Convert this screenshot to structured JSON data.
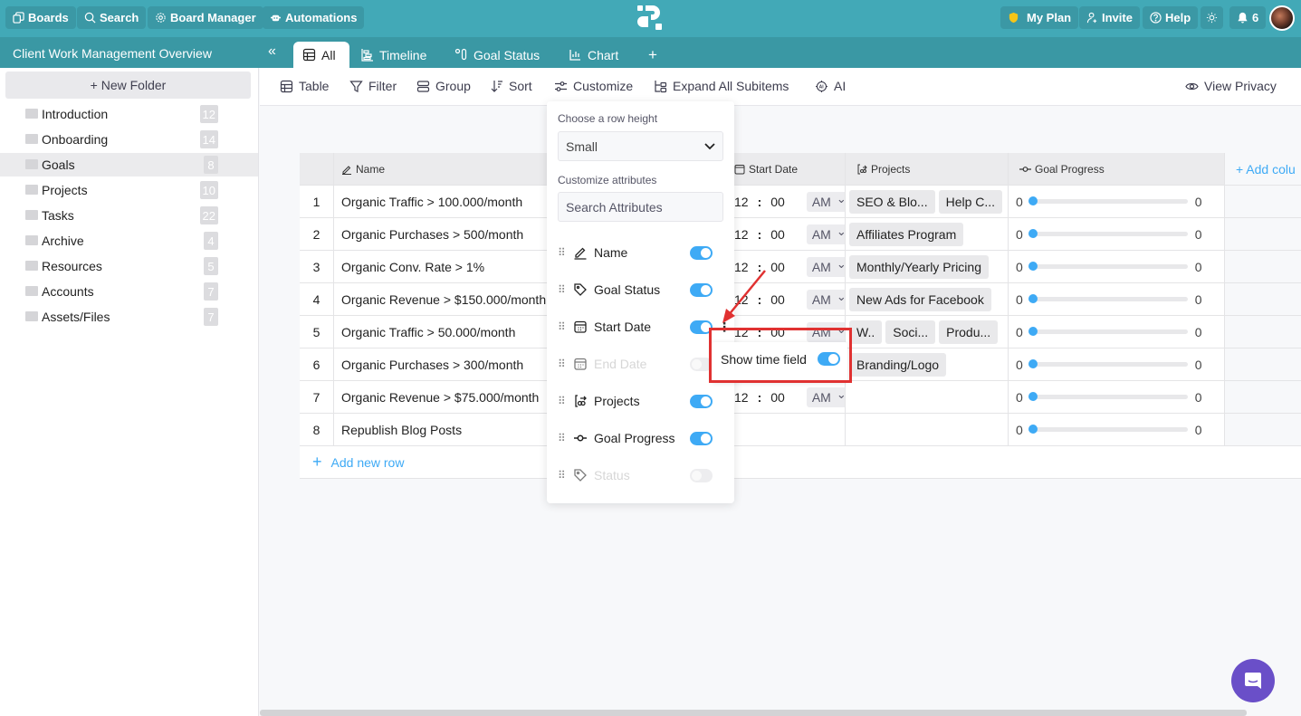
{
  "topbar": {
    "boards": "Boards",
    "search": "Search",
    "board_manager": "Board Manager",
    "automations": "Automations",
    "my_plan": "My Plan",
    "invite": "Invite",
    "help": "Help",
    "notifications_count": "6",
    "plan_color": "#f5c518"
  },
  "board": {
    "title": "Client Work Management Overview",
    "tabs": [
      {
        "label": "All",
        "icon": "table-icon",
        "active": true
      },
      {
        "label": "Timeline",
        "icon": "timeline-icon"
      },
      {
        "label": "Goal Status",
        "icon": "kanban-icon"
      },
      {
        "label": "Chart",
        "icon": "chart-icon"
      }
    ],
    "add_tab": "+"
  },
  "sidebar": {
    "new_folder": "+ New Folder",
    "folders": [
      {
        "name": "Introduction",
        "count": "12"
      },
      {
        "name": "Onboarding",
        "count": "14"
      },
      {
        "name": "Goals",
        "count": "8",
        "selected": true
      },
      {
        "name": "Projects",
        "count": "10"
      },
      {
        "name": "Tasks",
        "count": "22"
      },
      {
        "name": "Archive",
        "count": "4"
      },
      {
        "name": "Resources",
        "count": "5"
      },
      {
        "name": "Accounts",
        "count": "7"
      },
      {
        "name": "Assets/Files",
        "count": "7"
      }
    ]
  },
  "toolbar": {
    "table": "Table",
    "filter": "Filter",
    "group": "Group",
    "sort": "Sort",
    "customize": "Customize",
    "expand": "Expand All Subitems",
    "ai": "AI",
    "view_privacy": "View Privacy"
  },
  "table": {
    "headers": {
      "name": "Name",
      "start_date": "Start Date",
      "projects": "Projects",
      "goal_progress": "Goal Progress",
      "add_column": "+ Add colu"
    },
    "rows": [
      {
        "num": "1",
        "name": "Organic Traffic > 100.000/month",
        "hour": "12",
        "minute": "00",
        "ampm": "AM",
        "projects": [
          "SEO & Blo...",
          "Help C..."
        ],
        "progress_min": "0",
        "progress_max": "0",
        "progress": 0
      },
      {
        "num": "2",
        "name": "Organic Purchases > 500/month",
        "hour": "12",
        "minute": "00",
        "ampm": "AM",
        "projects": [
          "Affiliates Program"
        ],
        "progress_min": "0",
        "progress_max": "0",
        "progress": 0
      },
      {
        "num": "3",
        "name": "Organic Conv. Rate > 1%",
        "hour": "12",
        "minute": "00",
        "ampm": "AM",
        "projects": [
          "Monthly/Yearly Pricing"
        ],
        "progress_min": "0",
        "progress_max": "0",
        "progress": 0
      },
      {
        "num": "4",
        "name": "Organic Revenue > $150.000/month",
        "hour": "12",
        "minute": "00",
        "ampm": "AM",
        "projects": [
          "New Ads for Facebook"
        ],
        "progress_min": "0",
        "progress_max": "0",
        "progress": 0
      },
      {
        "num": "5",
        "name": "Organic Traffic > 50.000/month",
        "hour": "12",
        "minute": "00",
        "ampm": "AM",
        "projects": [
          "W..",
          "Soci...",
          "Produ..."
        ],
        "progress_min": "0",
        "progress_max": "0",
        "progress": 0
      },
      {
        "num": "6",
        "name": "Organic Purchases > 300/month",
        "hour": "",
        "minute": "",
        "ampm": "",
        "projects": [
          "Branding/Logo"
        ],
        "progress_min": "0",
        "progress_max": "0",
        "progress": 0
      },
      {
        "num": "7",
        "name": "Organic Revenue > $75.000/month",
        "hour": "12",
        "minute": "00",
        "ampm": "AM",
        "projects": [],
        "progress_min": "0",
        "progress_max": "0",
        "progress": 0
      },
      {
        "num": "8",
        "name": "Republish Blog Posts",
        "hour": "",
        "minute": "",
        "ampm": "",
        "projects": [],
        "progress_min": "0",
        "progress_max": "0",
        "progress": 0
      }
    ],
    "add_row": "Add new row"
  },
  "customize_popup": {
    "row_height_label": "Choose a row height",
    "row_height_value": "Small",
    "attributes_label": "Customize attributes",
    "search_placeholder": "Search Attributes",
    "attributes": [
      {
        "name": "Name",
        "icon": "pencil-icon",
        "enabled": true
      },
      {
        "name": "Goal Status",
        "icon": "tag-icon",
        "enabled": true
      },
      {
        "name": "Start Date",
        "icon": "calendar-icon",
        "enabled": true
      },
      {
        "name": "End Date",
        "icon": "calendar-icon",
        "enabled": false
      },
      {
        "name": "Projects",
        "icon": "link-icon",
        "enabled": true
      },
      {
        "name": "Goal Progress",
        "icon": "progress-icon",
        "enabled": true
      },
      {
        "name": "Status",
        "icon": "tag-icon",
        "enabled": false
      }
    ]
  },
  "time_submenu": {
    "label": "Show time field",
    "enabled": true
  },
  "colors": {
    "accent": "#3eaaf5",
    "header": "#42a9b7",
    "highlight": "#e03131",
    "chat": "#6a4fc8"
  }
}
